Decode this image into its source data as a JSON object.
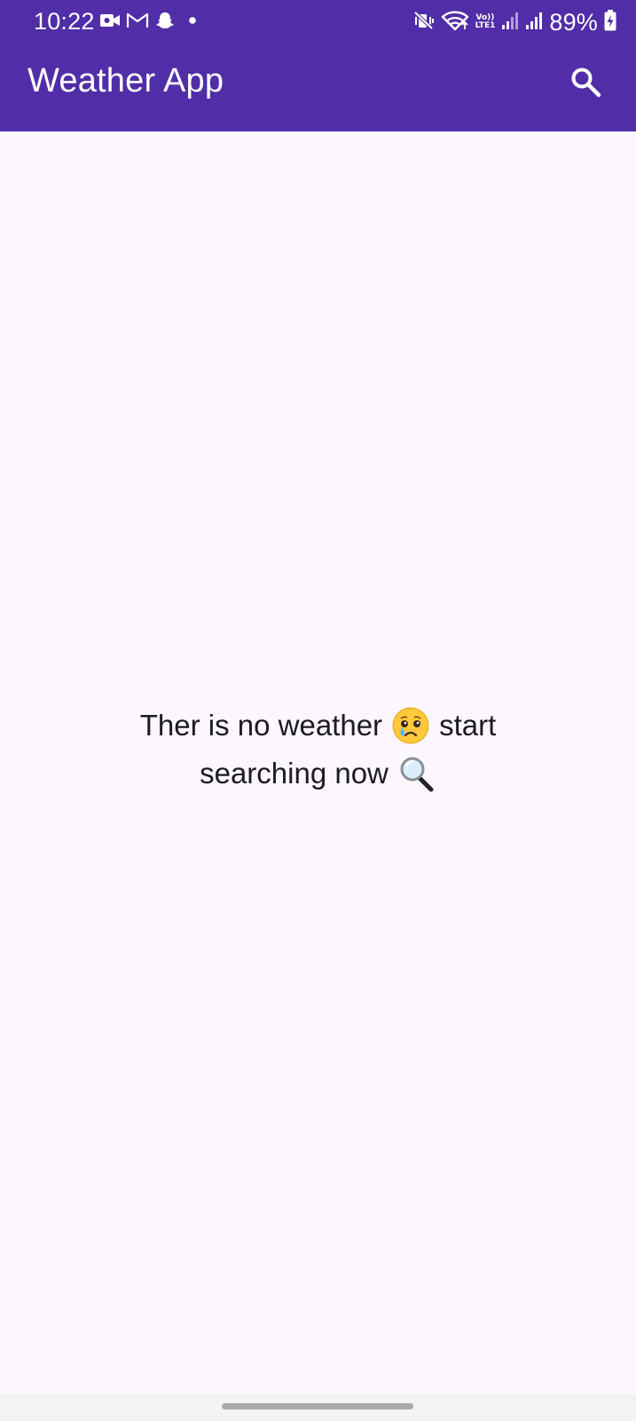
{
  "status_bar": {
    "time": "10:22",
    "left_icons": [
      "video-camera-icon",
      "gmail-icon",
      "snapchat-ghost-icon",
      "notification-dot-icon"
    ],
    "right_icons": [
      "mute-vibrate-icon",
      "wifi-icon",
      "volte-lte1-icon",
      "signal-icon",
      "signal-icon",
      "battery-charging-icon"
    ],
    "volte_top": "Vo))",
    "volte_bottom": "LTE1",
    "battery_percent": "89%"
  },
  "app_bar": {
    "title": "Weather App",
    "search_icon": "search-icon",
    "color": "#512DA8"
  },
  "main": {
    "empty_message": {
      "line1_a": "Ther is no weather",
      "emoji1": "crying-face-icon",
      "line1_b": "start",
      "line2": "searching now",
      "emoji2": "magnifying-glass-icon"
    },
    "background": "#FCF7FD"
  },
  "navigation": {
    "home_handle": "home-gesture-handle"
  }
}
